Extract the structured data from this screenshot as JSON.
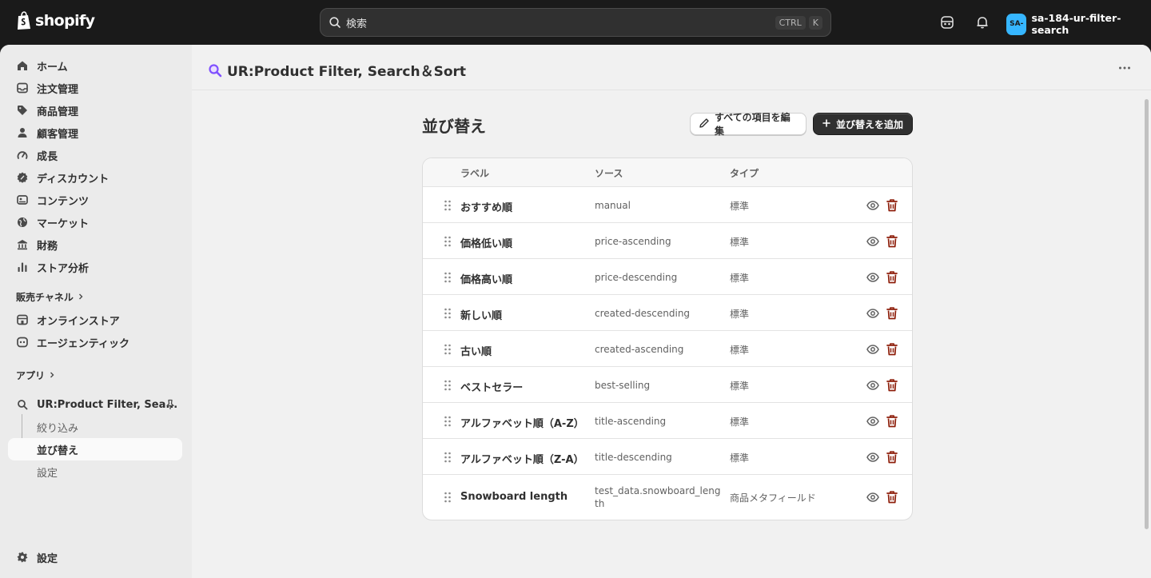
{
  "topbar": {
    "logo_text": "shopify",
    "search_placeholder": "検索",
    "shortcut_ctrl": "CTRL",
    "shortcut_key": "K",
    "avatar_initials": "SA-",
    "store_name": "sa-184-ur-filter-search"
  },
  "sidebar": {
    "items": [
      {
        "label": "ホーム",
        "icon": "home-icon"
      },
      {
        "label": "注文管理",
        "icon": "inbox-icon"
      },
      {
        "label": "商品管理",
        "icon": "tag-icon"
      },
      {
        "label": "顧客管理",
        "icon": "person-icon"
      },
      {
        "label": "成長",
        "icon": "gauge-icon"
      },
      {
        "label": "ディスカウント",
        "icon": "discount-icon"
      },
      {
        "label": "コンテンツ",
        "icon": "content-icon"
      },
      {
        "label": "マーケット",
        "icon": "globe-icon"
      },
      {
        "label": "財務",
        "icon": "bank-icon"
      },
      {
        "label": "ストア分析",
        "icon": "chart-bar-icon"
      }
    ],
    "sales_channels_label": "販売チャネル",
    "channels": [
      {
        "label": "オンラインストア",
        "icon": "store-icon"
      },
      {
        "label": "エージェンティック",
        "icon": "agentic-icon"
      }
    ],
    "apps_label": "アプリ",
    "app_name": "UR:Product Filter, Sea...",
    "app_sub_items": [
      "絞り込み",
      "並び替え",
      "設定"
    ],
    "settings_label": "設定"
  },
  "app_header": {
    "title": "UR:Product Filter, Search＆Sort"
  },
  "page": {
    "title": "並び替え",
    "edit_all_button": "すべての項目を編集",
    "add_sort_button": "並び替えを追加"
  },
  "table": {
    "headers": {
      "label": "ラベル",
      "source": "ソース",
      "type": "タイプ"
    },
    "rows": [
      {
        "label": "おすすめ順",
        "source": "manual",
        "type": "標準"
      },
      {
        "label": "価格低い順",
        "source": "price-ascending",
        "type": "標準"
      },
      {
        "label": "価格高い順",
        "source": "price-descending",
        "type": "標準"
      },
      {
        "label": "新しい順",
        "source": "created-descending",
        "type": "標準"
      },
      {
        "label": "古い順",
        "source": "created-ascending",
        "type": "標準"
      },
      {
        "label": "ベストセラー",
        "source": "best-selling",
        "type": "標準"
      },
      {
        "label": "アルファベット順（A-Z）",
        "source": "title-ascending",
        "type": "標準"
      },
      {
        "label": "アルファベット順（Z-A）",
        "source": "title-descending",
        "type": "標準"
      },
      {
        "label": "Snowboard length",
        "source": "test_data.snowboard_length",
        "type": "商品メタフィールド"
      }
    ]
  },
  "colors": {
    "topbar_bg": "#1a1a1a",
    "primary_button": "#303030",
    "delete_icon": "#8e1f0b",
    "avatar_bg": "#36b6ff"
  }
}
